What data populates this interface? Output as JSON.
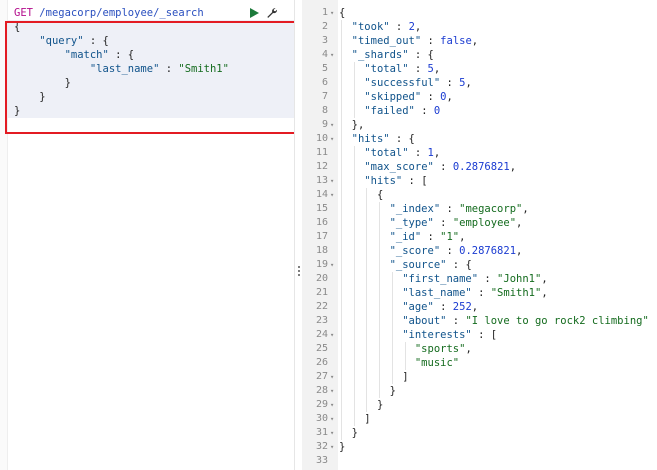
{
  "request": {
    "method": "GET",
    "url": "/megacorp/employee/_search",
    "lines": [
      {
        "text": "{"
      },
      {
        "indent": 4,
        "key": "\"query\"",
        "rest": " : {"
      },
      {
        "indent": 8,
        "key": "\"match\"",
        "rest": " : {"
      },
      {
        "indent": 12,
        "key": "\"last_name\"",
        "sep": " : ",
        "str": "\"Smith1\""
      },
      {
        "indent": 8,
        "text": "}"
      },
      {
        "indent": 4,
        "text": "}"
      },
      {
        "text": "}"
      }
    ]
  },
  "icons": {
    "run": "play-icon",
    "settings": "wrench-icon",
    "handle": "drag-handle-icon"
  },
  "colors": {
    "highlight_box": "#e31b23",
    "key": "#10538b",
    "string": "#146b1e",
    "number": "#1a3bd1",
    "method": "#b30d8c"
  },
  "response": {
    "lines": [
      {
        "n": "1",
        "fold": true,
        "indent": 0,
        "parts": [
          {
            "t": "{",
            "c": "punc"
          }
        ]
      },
      {
        "n": "2",
        "fold": false,
        "indent": 2,
        "parts": [
          {
            "t": "\"took\"",
            "c": "key"
          },
          {
            "t": " : ",
            "c": "punc"
          },
          {
            "t": "2",
            "c": "num"
          },
          {
            "t": ",",
            "c": "punc"
          }
        ]
      },
      {
        "n": "3",
        "fold": false,
        "indent": 2,
        "parts": [
          {
            "t": "\"timed_out\"",
            "c": "key"
          },
          {
            "t": " : ",
            "c": "punc"
          },
          {
            "t": "false",
            "c": "kw"
          },
          {
            "t": ",",
            "c": "punc"
          }
        ]
      },
      {
        "n": "4",
        "fold": true,
        "indent": 2,
        "parts": [
          {
            "t": "\"_shards\"",
            "c": "key"
          },
          {
            "t": " : {",
            "c": "punc"
          }
        ]
      },
      {
        "n": "5",
        "fold": false,
        "indent": 4,
        "parts": [
          {
            "t": "\"total\"",
            "c": "key"
          },
          {
            "t": " : ",
            "c": "punc"
          },
          {
            "t": "5",
            "c": "num"
          },
          {
            "t": ",",
            "c": "punc"
          }
        ]
      },
      {
        "n": "6",
        "fold": false,
        "indent": 4,
        "parts": [
          {
            "t": "\"successful\"",
            "c": "key"
          },
          {
            "t": " : ",
            "c": "punc"
          },
          {
            "t": "5",
            "c": "num"
          },
          {
            "t": ",",
            "c": "punc"
          }
        ]
      },
      {
        "n": "7",
        "fold": false,
        "indent": 4,
        "parts": [
          {
            "t": "\"skipped\"",
            "c": "key"
          },
          {
            "t": " : ",
            "c": "punc"
          },
          {
            "t": "0",
            "c": "num"
          },
          {
            "t": ",",
            "c": "punc"
          }
        ]
      },
      {
        "n": "8",
        "fold": false,
        "indent": 4,
        "parts": [
          {
            "t": "\"failed\"",
            "c": "key"
          },
          {
            "t": " : ",
            "c": "punc"
          },
          {
            "t": "0",
            "c": "num"
          }
        ]
      },
      {
        "n": "9",
        "fold": true,
        "indent": 2,
        "parts": [
          {
            "t": "},",
            "c": "punc"
          }
        ]
      },
      {
        "n": "10",
        "fold": true,
        "indent": 2,
        "parts": [
          {
            "t": "\"hits\"",
            "c": "key"
          },
          {
            "t": " : {",
            "c": "punc"
          }
        ]
      },
      {
        "n": "11",
        "fold": false,
        "indent": 4,
        "parts": [
          {
            "t": "\"total\"",
            "c": "key"
          },
          {
            "t": " : ",
            "c": "punc"
          },
          {
            "t": "1",
            "c": "num"
          },
          {
            "t": ",",
            "c": "punc"
          }
        ]
      },
      {
        "n": "12",
        "fold": false,
        "indent": 4,
        "parts": [
          {
            "t": "\"max_score\"",
            "c": "key"
          },
          {
            "t": " : ",
            "c": "punc"
          },
          {
            "t": "0.2876821",
            "c": "num"
          },
          {
            "t": ",",
            "c": "punc"
          }
        ]
      },
      {
        "n": "13",
        "fold": true,
        "indent": 4,
        "parts": [
          {
            "t": "\"hits\"",
            "c": "key"
          },
          {
            "t": " : [",
            "c": "punc"
          }
        ]
      },
      {
        "n": "14",
        "fold": true,
        "indent": 6,
        "parts": [
          {
            "t": "{",
            "c": "punc"
          }
        ]
      },
      {
        "n": "15",
        "fold": false,
        "indent": 8,
        "parts": [
          {
            "t": "\"_index\"",
            "c": "key"
          },
          {
            "t": " : ",
            "c": "punc"
          },
          {
            "t": "\"megacorp\"",
            "c": "str"
          },
          {
            "t": ",",
            "c": "punc"
          }
        ]
      },
      {
        "n": "16",
        "fold": false,
        "indent": 8,
        "parts": [
          {
            "t": "\"_type\"",
            "c": "key"
          },
          {
            "t": " : ",
            "c": "punc"
          },
          {
            "t": "\"employee\"",
            "c": "str"
          },
          {
            "t": ",",
            "c": "punc"
          }
        ]
      },
      {
        "n": "17",
        "fold": false,
        "indent": 8,
        "parts": [
          {
            "t": "\"_id\"",
            "c": "key"
          },
          {
            "t": " : ",
            "c": "punc"
          },
          {
            "t": "\"1\"",
            "c": "str"
          },
          {
            "t": ",",
            "c": "punc"
          }
        ]
      },
      {
        "n": "18",
        "fold": false,
        "indent": 8,
        "parts": [
          {
            "t": "\"_score\"",
            "c": "key"
          },
          {
            "t": " : ",
            "c": "punc"
          },
          {
            "t": "0.2876821",
            "c": "num"
          },
          {
            "t": ",",
            "c": "punc"
          }
        ]
      },
      {
        "n": "19",
        "fold": true,
        "indent": 8,
        "parts": [
          {
            "t": "\"_source\"",
            "c": "key"
          },
          {
            "t": " : {",
            "c": "punc"
          }
        ]
      },
      {
        "n": "20",
        "fold": false,
        "indent": 10,
        "parts": [
          {
            "t": "\"first_name\"",
            "c": "key"
          },
          {
            "t": " : ",
            "c": "punc"
          },
          {
            "t": "\"John1\"",
            "c": "str"
          },
          {
            "t": ",",
            "c": "punc"
          }
        ]
      },
      {
        "n": "21",
        "fold": false,
        "indent": 10,
        "parts": [
          {
            "t": "\"last_name\"",
            "c": "key"
          },
          {
            "t": " : ",
            "c": "punc"
          },
          {
            "t": "\"Smith1\"",
            "c": "str"
          },
          {
            "t": ",",
            "c": "punc"
          }
        ]
      },
      {
        "n": "22",
        "fold": false,
        "indent": 10,
        "parts": [
          {
            "t": "\"age\"",
            "c": "key"
          },
          {
            "t": " : ",
            "c": "punc"
          },
          {
            "t": "252",
            "c": "num"
          },
          {
            "t": ",",
            "c": "punc"
          }
        ]
      },
      {
        "n": "23",
        "fold": false,
        "indent": 10,
        "parts": [
          {
            "t": "\"about\"",
            "c": "key"
          },
          {
            "t": " : ",
            "c": "punc"
          },
          {
            "t": "\"I love to go rock2 climbing\"",
            "c": "str"
          }
        ]
      },
      {
        "n": "24",
        "fold": true,
        "indent": 10,
        "parts": [
          {
            "t": "\"interests\"",
            "c": "key"
          },
          {
            "t": " : [",
            "c": "punc"
          }
        ]
      },
      {
        "n": "25",
        "fold": false,
        "indent": 12,
        "parts": [
          {
            "t": "\"sports\"",
            "c": "str"
          },
          {
            "t": ",",
            "c": "punc"
          }
        ]
      },
      {
        "n": "26",
        "fold": false,
        "indent": 12,
        "parts": [
          {
            "t": "\"music\"",
            "c": "str"
          }
        ]
      },
      {
        "n": "27",
        "fold": true,
        "indent": 10,
        "parts": [
          {
            "t": "]",
            "c": "punc"
          }
        ]
      },
      {
        "n": "28",
        "fold": true,
        "indent": 8,
        "parts": [
          {
            "t": "}",
            "c": "punc"
          }
        ]
      },
      {
        "n": "29",
        "fold": true,
        "indent": 6,
        "parts": [
          {
            "t": "}",
            "c": "punc"
          }
        ]
      },
      {
        "n": "30",
        "fold": true,
        "indent": 4,
        "parts": [
          {
            "t": "]",
            "c": "punc"
          }
        ]
      },
      {
        "n": "31",
        "fold": true,
        "indent": 2,
        "parts": [
          {
            "t": "}",
            "c": "punc"
          }
        ]
      },
      {
        "n": "32",
        "fold": true,
        "indent": 0,
        "parts": [
          {
            "t": "}",
            "c": "punc"
          }
        ]
      },
      {
        "n": "33",
        "fold": false,
        "indent": 0,
        "parts": []
      }
    ]
  }
}
